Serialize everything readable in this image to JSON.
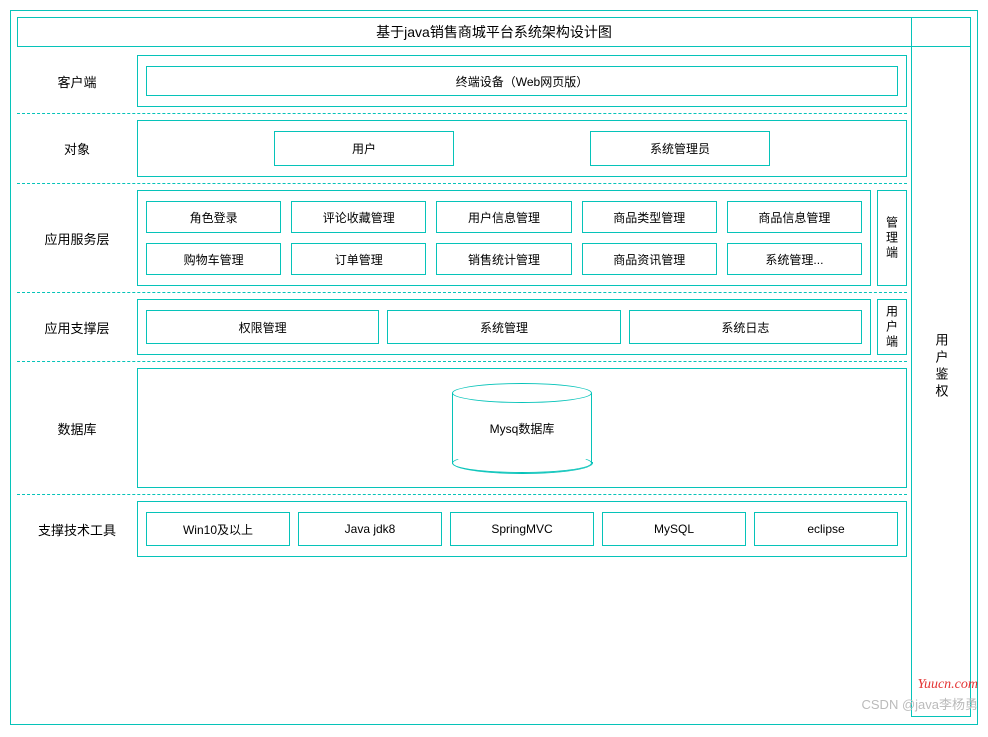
{
  "title": "基于java销售商城平台系统架构设计图",
  "right_sidebar": {
    "auth": "用户鉴权"
  },
  "rows": {
    "client": {
      "label": "客户端",
      "items": [
        "终端设备（Web网页版）"
      ]
    },
    "object": {
      "label": "对象",
      "items": [
        "用户",
        "系统管理员"
      ]
    },
    "service": {
      "label": "应用服务层",
      "grid": [
        [
          "角色登录",
          "评论收藏管理",
          "用户信息管理",
          "商品类型管理",
          "商品信息管理"
        ],
        [
          "购物车管理",
          "订单管理",
          "销售统计管理",
          "商品资讯管理",
          "系统管理..."
        ]
      ],
      "tags": [
        "管理端",
        "用户端"
      ]
    },
    "support": {
      "label": "应用支撑层",
      "items": [
        "权限管理",
        "系统管理",
        "系统日志"
      ]
    },
    "database": {
      "label": "数据库",
      "cylinder": "Mysq数据库"
    },
    "tools": {
      "label": "支撑技术工具",
      "items": [
        "Win10及以上",
        "Java jdk8",
        "SpringMVC",
        "MySQL",
        "eclipse"
      ]
    }
  },
  "watermarks": {
    "site": "Yuucn.com",
    "author": "CSDN @java李杨勇"
  }
}
